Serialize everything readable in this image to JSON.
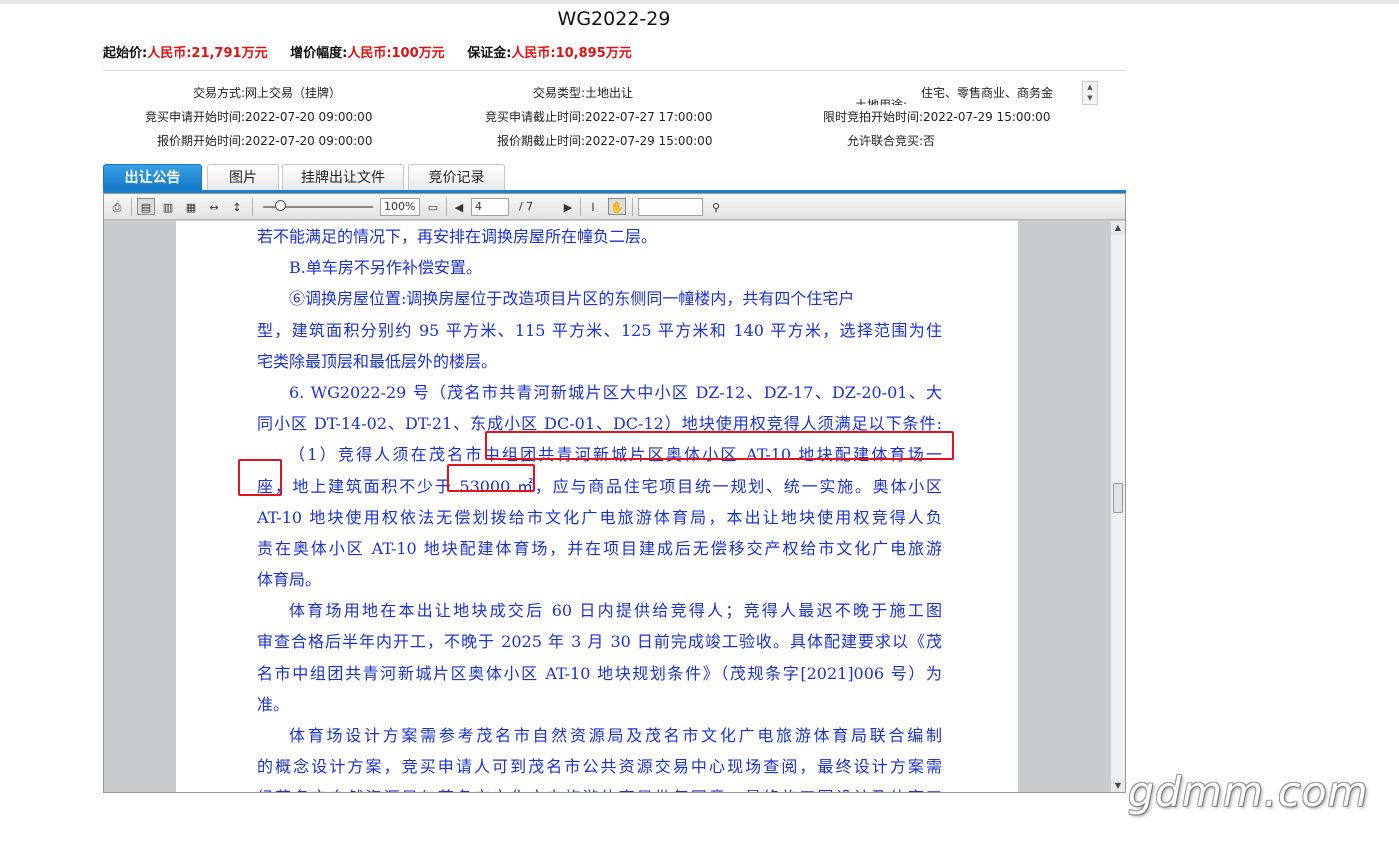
{
  "title": "WG2022-29",
  "prices": [
    {
      "label": "起始价:",
      "value": "人民币:21,791万元"
    },
    {
      "label": "增价幅度:",
      "value": "人民币:100万元"
    },
    {
      "label": "保证金:",
      "value": "人民币:10,895万元"
    }
  ],
  "info": {
    "trade_mode": {
      "label": "交易方式:",
      "value": "网上交易（挂牌）"
    },
    "trade_type": {
      "label": "交易类型:",
      "value": "土地出让"
    },
    "land_use": {
      "label": "土地用途:",
      "value": "住宅、零售商业、商务金"
    },
    "apply_start": {
      "label": "竞买申请开始时间:",
      "value": "2022-07-20 09:00:00"
    },
    "apply_end": {
      "label": "竞买申请截止时间:",
      "value": "2022-07-27 17:00:00"
    },
    "limit_start": {
      "label": "限时竞拍开始时间:",
      "value": "2022-07-29 15:00:00"
    },
    "quote_start": {
      "label": "报价期开始时间:",
      "value": "2022-07-20 09:00:00"
    },
    "quote_end": {
      "label": "报价期截止时间:",
      "value": "2022-07-29 15:00:00"
    },
    "joint_bid": {
      "label": "允许联合竞买:",
      "value": "否"
    }
  },
  "tabs": [
    {
      "label": "出让公告",
      "active": true
    },
    {
      "label": "图片",
      "active": false
    },
    {
      "label": "挂牌出让文件",
      "active": false
    },
    {
      "label": "竞价记录",
      "active": false
    }
  ],
  "toolbar": {
    "zoom": "100%",
    "page_current": "4",
    "page_total": "/ 7",
    "search_placeholder": ""
  },
  "doc": {
    "lines": [
      "若不能满足的情况下，再安排在调换房屋所在幢负二层。",
      "B.单车房不另作补偿安置。",
      "⑥调换房屋位置:调换房屋位于改造项目片区的东侧同一幢楼内，共有四个住宅户",
      "型，建筑面积分别约 95 平方米、115 平方米、125 平方米和 140 平方米，选择范围为住",
      "宅类除最顶层和最低层外的楼层。",
      "6. WG2022-29 号（茂名市共青河新城片区大中小区 DZ-12、DZ-17、DZ-20-01、大",
      "同小区 DT-14-02、DT-21、东成小区 DC-01、DC-12）地块使用权竞得人须满足以下条件:",
      "（1）竞得人须在茂名市中组团共青河新城片区奥体小区 AT-10 地块配建体育场一",
      "座，地上建筑面积不少于 53000 ㎡，应与商品住宅项目统一规划、统一实施。奥体小区",
      "AT-10 地块使用权依法无偿划拨给市文化广电旅游体育局，本出让地块使用权竞得人负",
      "责在奥体小区 AT-10 地块配建体育场，并在项目建成后无偿移交产权给市文化广电旅游",
      "体育局。",
      "体育场用地在本出让地块成交后 60 日内提供给竞得人；竞得人最迟不晚于施工图",
      "审查合格后半年内开工，不晚于 2025 年 3 月 30 日前完成竣工验收。具体配建要求以《茂",
      "名市中组团共青河新城片区奥体小区 AT-10 地块规划条件》（茂规条字[2021]006 号）为",
      "准。",
      "体育场设计方案需参考茂名市自然资源局及茂名市文化广电旅游体育局联合编制",
      "的概念设计方案，竞买申请人可到茂名市公共资源交易中心现场查阅，最终设计方案需",
      "经茂名市自然资源局与茂名市文化广电旅游体育局批复同意，最终施工图设计及体育工"
    ]
  },
  "watermark": "gdmm.com",
  "colors": {
    "price_value": "#dd1111",
    "doc_text": "#1b33c9",
    "highlight_box": "#e0141e",
    "tab_active": "#1a7fcc"
  }
}
